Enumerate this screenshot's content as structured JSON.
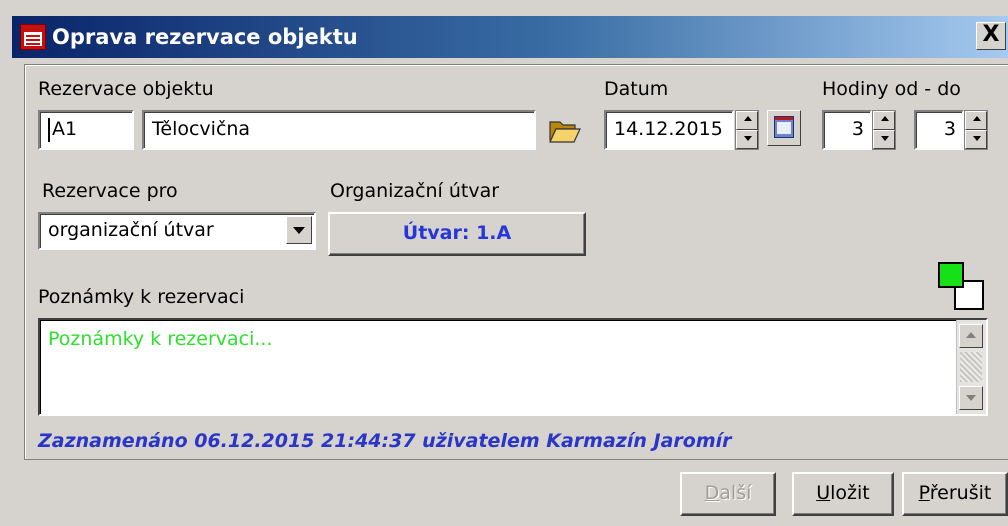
{
  "window": {
    "title": "Oprava rezervace objektu",
    "close_label": "X"
  },
  "object": {
    "label": "Rezervace objektu",
    "code": "A1",
    "name": "Tělocvična"
  },
  "date": {
    "label": "Datum",
    "value": "14.12.2015"
  },
  "hours": {
    "label": "Hodiny od - do",
    "from": "3",
    "to": "3"
  },
  "reservation_for": {
    "label": "Rezervace pro",
    "value": "organizační útvar"
  },
  "org_unit": {
    "label": "Organizační útvar",
    "button_label": "Útvar: 1.A"
  },
  "notes": {
    "label": "Poznámky k rezervaci",
    "placeholder": "Poznámky k rezervaci..."
  },
  "colors": {
    "foreground": "#16e016",
    "background": "#ffffff",
    "link_text": "#2636d8",
    "placeholder_text": "#2ee02e"
  },
  "recorded": "Zaznamenáno 06.12.2015 21:44:37 uživatelem Karmazín Jaromír",
  "buttons": {
    "next": {
      "pre": "",
      "key": "D",
      "post": "alší"
    },
    "save": {
      "pre": "",
      "key": "U",
      "post": "ložit"
    },
    "cancel": {
      "pre": "",
      "key": "P",
      "post": "řerušit"
    }
  },
  "icons": {
    "title": "calendar-icon",
    "browse": "folder-open-icon",
    "calendar": "calendar-picker-icon"
  }
}
